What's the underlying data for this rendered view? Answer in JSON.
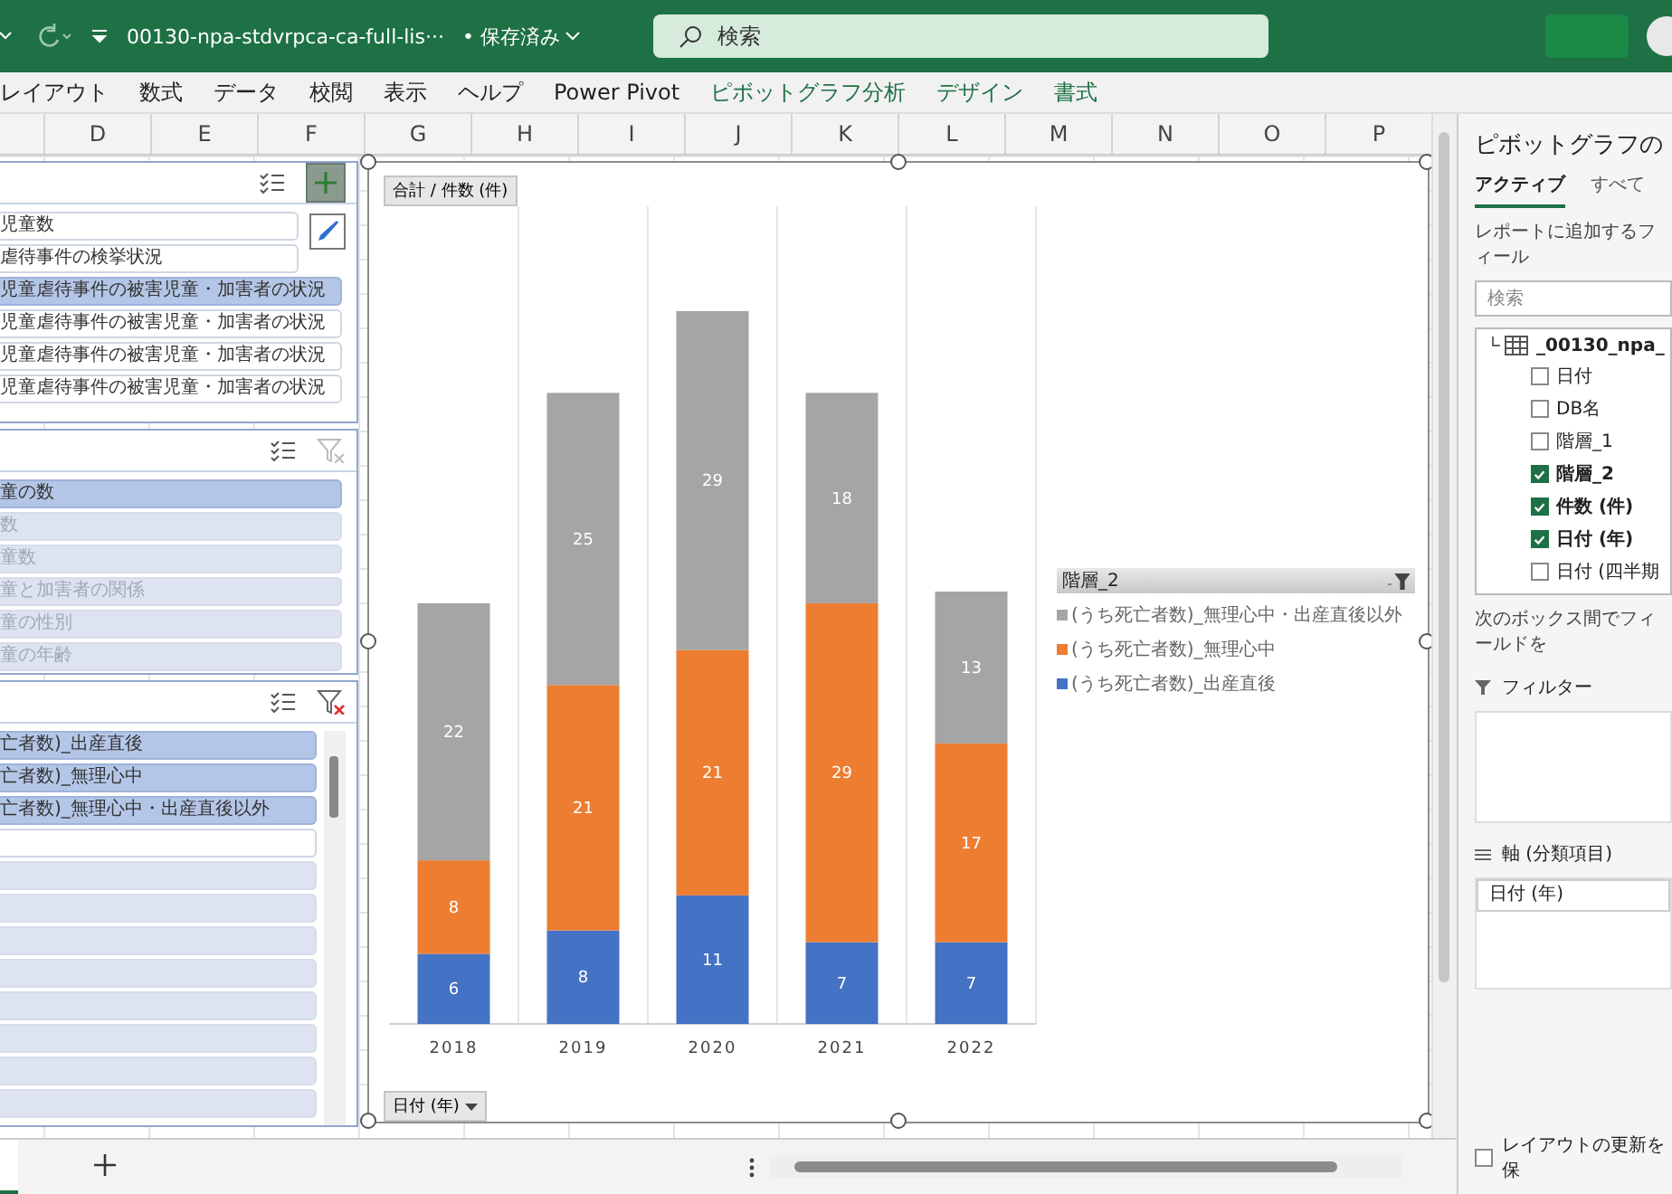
{
  "title_bar": {
    "file_name": "00130-npa-stdvrpca-ca-full-lis···",
    "save_status": "• 保存済み",
    "search_placeholder": "検索"
  },
  "ribbon_tabs": [
    {
      "label": "レイアウト",
      "kind": "normal"
    },
    {
      "label": "数式",
      "kind": "normal"
    },
    {
      "label": "データ",
      "kind": "normal"
    },
    {
      "label": "校閲",
      "kind": "normal"
    },
    {
      "label": "表示",
      "kind": "normal"
    },
    {
      "label": "ヘルプ",
      "kind": "normal"
    },
    {
      "label": "Power Pivot",
      "kind": "normal"
    },
    {
      "label": "ピボットグラフ分析",
      "kind": "contextual"
    },
    {
      "label": "デザイン",
      "kind": "contextual"
    },
    {
      "label": "書式",
      "kind": "contextual"
    }
  ],
  "column_headers": [
    "D",
    "E",
    "F",
    "G",
    "H",
    "I",
    "J",
    "K",
    "L",
    "M",
    "N",
    "O",
    "P"
  ],
  "slicers": [
    {
      "kind": "tools",
      "items": [
        {
          "label": "児童数",
          "selected": false,
          "disabled": false
        },
        {
          "label": "虐待事件の検挙状況",
          "selected": false,
          "disabled": false
        },
        {
          "label": "児童虐待事件の被害児童・加害者の状況",
          "selected": true,
          "disabled": false
        },
        {
          "label": "児童虐待事件の被害児童・加害者の状況",
          "selected": false,
          "disabled": false
        },
        {
          "label": "児童虐待事件の被害児童・加害者の状況",
          "selected": false,
          "disabled": false
        },
        {
          "label": "児童虐待事件の被害児童・加害者の状況",
          "selected": false,
          "disabled": false
        }
      ]
    },
    {
      "kind": "standard",
      "filtered": false,
      "items": [
        {
          "label": "童の数",
          "selected": true,
          "disabled": false
        },
        {
          "label": "数",
          "selected": false,
          "disabled": true
        },
        {
          "label": "童数",
          "selected": false,
          "disabled": true
        },
        {
          "label": "童と加害者の関係",
          "selected": false,
          "disabled": true
        },
        {
          "label": "童の性別",
          "selected": false,
          "disabled": true
        },
        {
          "label": "童の年齢",
          "selected": false,
          "disabled": true
        }
      ]
    },
    {
      "kind": "scrolling",
      "filtered": true,
      "items": [
        {
          "label": "亡者数)_出産直後",
          "selected": true,
          "disabled": false
        },
        {
          "label": "亡者数)_無理心中",
          "selected": true,
          "disabled": false
        },
        {
          "label": "亡者数)_無理心中・出産直後以外",
          "selected": true,
          "disabled": false
        },
        {
          "selected": false,
          "disabled": false
        },
        {
          "selected": false,
          "disabled": true
        },
        {
          "selected": false,
          "disabled": true
        },
        {
          "selected": false,
          "disabled": true
        },
        {
          "selected": false,
          "disabled": true
        },
        {
          "selected": false,
          "disabled": true
        },
        {
          "selected": false,
          "disabled": true
        },
        {
          "selected": false,
          "disabled": true
        },
        {
          "selected": false,
          "disabled": true
        }
      ]
    }
  ],
  "chart": {
    "value_field_button": "合計 / 件数 (件)",
    "axis_field_button": "日付 (年)",
    "legend_title": "階層_2",
    "chart_data": {
      "type": "bar",
      "stacked": true,
      "data_labels": true,
      "categories": [
        "2018",
        "2019",
        "2020",
        "2021",
        "2022"
      ],
      "series": [
        {
          "name": "(うち死亡者数)_出産直後",
          "color": "#4472c4",
          "values": [
            6,
            8,
            11,
            7,
            7
          ]
        },
        {
          "name": "(うち死亡者数)_無理心中",
          "color": "#ed7d31",
          "values": [
            8,
            21,
            21,
            29,
            17
          ]
        },
        {
          "name": "(うち死亡者数)_無理心中・出産直後以外",
          "color": "#a5a5a5",
          "values": [
            22,
            25,
            29,
            18,
            13
          ]
        }
      ]
    }
  },
  "field_pane": {
    "title": "ピボットグラフの",
    "tabs": [
      {
        "label": "アクティブ",
        "selected": true
      },
      {
        "label": "すべて",
        "selected": false
      }
    ],
    "instruction": "レポートに追加するフィール",
    "search_placeholder": "検索",
    "table_name": "_00130_npa_",
    "fields": [
      {
        "label": "日付",
        "checked": false
      },
      {
        "label": "DB名",
        "checked": false
      },
      {
        "label": "階層_1",
        "checked": false
      },
      {
        "label": "階層_2",
        "checked": true
      },
      {
        "label": "件数 (件)",
        "checked": true
      },
      {
        "label": "日付 (年)",
        "checked": true
      },
      {
        "label": "日付 (四半期",
        "checked": false
      }
    ],
    "areas_instruction": "次のボックス間でフィールドを",
    "areas": [
      {
        "kind": "filter",
        "label": "フィルター"
      },
      {
        "kind": "axis",
        "label": "軸 (分類項目)",
        "items": [
          "日付 (年)"
        ]
      }
    ],
    "defer_update": {
      "label": "レイアウトの更新を保",
      "checked": false
    }
  }
}
